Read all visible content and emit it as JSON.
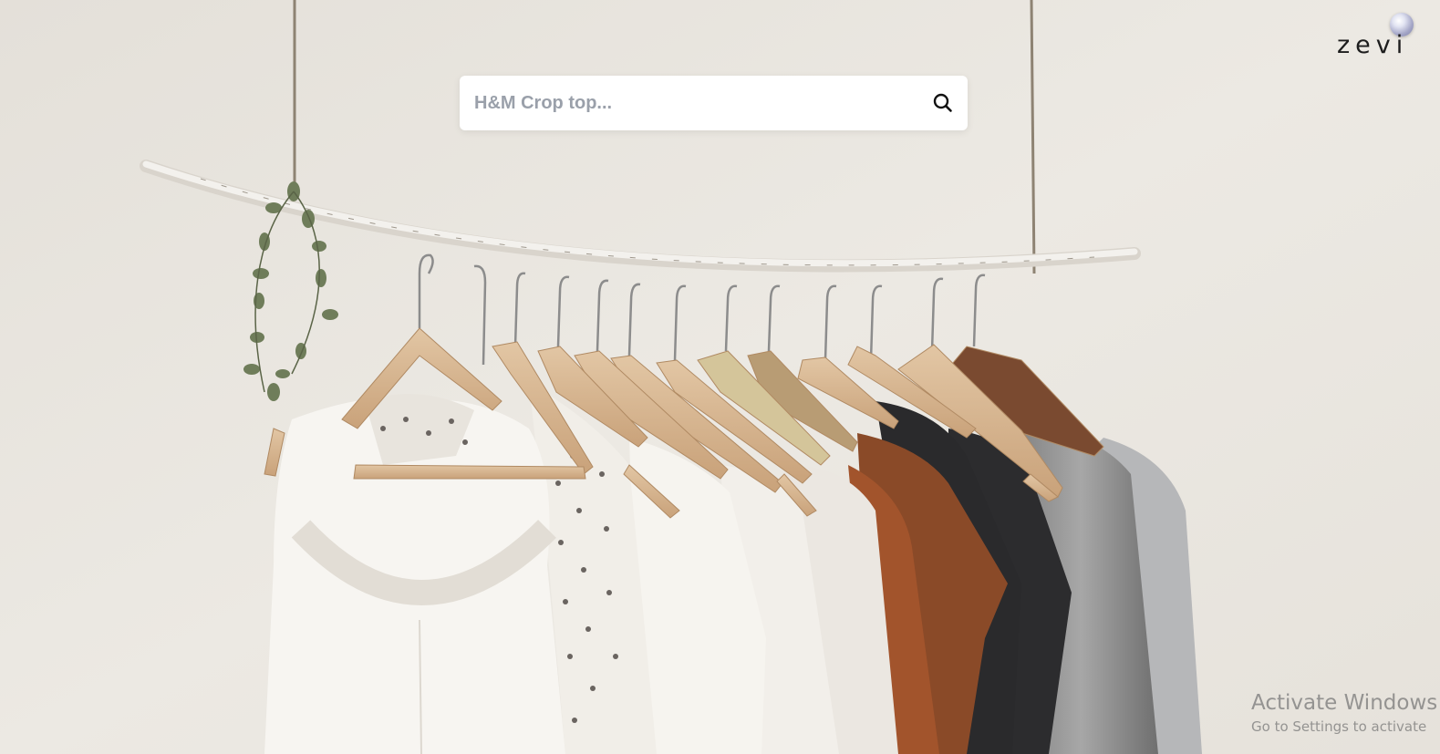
{
  "brand": {
    "logo_text": "zevi",
    "accent": "#a6a8c8"
  },
  "search": {
    "placeholder": "H&M Crop top...",
    "value": "",
    "icon": "search-icon"
  },
  "background": {
    "description_icon": "clothing-rack-photo",
    "wall_color": "#e9e5df"
  },
  "os_watermark": {
    "title": "Activate Windows",
    "subtitle": "Go to Settings to activate"
  }
}
